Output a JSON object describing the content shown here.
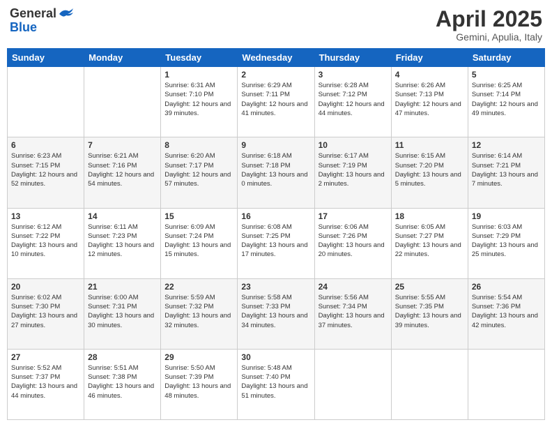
{
  "header": {
    "logo_general": "General",
    "logo_blue": "Blue",
    "month": "April 2025",
    "location": "Gemini, Apulia, Italy"
  },
  "weekdays": [
    "Sunday",
    "Monday",
    "Tuesday",
    "Wednesday",
    "Thursday",
    "Friday",
    "Saturday"
  ],
  "weeks": [
    [
      {
        "day": "",
        "info": ""
      },
      {
        "day": "",
        "info": ""
      },
      {
        "day": "1",
        "info": "Sunrise: 6:31 AM\nSunset: 7:10 PM\nDaylight: 12 hours and 39 minutes."
      },
      {
        "day": "2",
        "info": "Sunrise: 6:29 AM\nSunset: 7:11 PM\nDaylight: 12 hours and 41 minutes."
      },
      {
        "day": "3",
        "info": "Sunrise: 6:28 AM\nSunset: 7:12 PM\nDaylight: 12 hours and 44 minutes."
      },
      {
        "day": "4",
        "info": "Sunrise: 6:26 AM\nSunset: 7:13 PM\nDaylight: 12 hours and 47 minutes."
      },
      {
        "day": "5",
        "info": "Sunrise: 6:25 AM\nSunset: 7:14 PM\nDaylight: 12 hours and 49 minutes."
      }
    ],
    [
      {
        "day": "6",
        "info": "Sunrise: 6:23 AM\nSunset: 7:15 PM\nDaylight: 12 hours and 52 minutes."
      },
      {
        "day": "7",
        "info": "Sunrise: 6:21 AM\nSunset: 7:16 PM\nDaylight: 12 hours and 54 minutes."
      },
      {
        "day": "8",
        "info": "Sunrise: 6:20 AM\nSunset: 7:17 PM\nDaylight: 12 hours and 57 minutes."
      },
      {
        "day": "9",
        "info": "Sunrise: 6:18 AM\nSunset: 7:18 PM\nDaylight: 13 hours and 0 minutes."
      },
      {
        "day": "10",
        "info": "Sunrise: 6:17 AM\nSunset: 7:19 PM\nDaylight: 13 hours and 2 minutes."
      },
      {
        "day": "11",
        "info": "Sunrise: 6:15 AM\nSunset: 7:20 PM\nDaylight: 13 hours and 5 minutes."
      },
      {
        "day": "12",
        "info": "Sunrise: 6:14 AM\nSunset: 7:21 PM\nDaylight: 13 hours and 7 minutes."
      }
    ],
    [
      {
        "day": "13",
        "info": "Sunrise: 6:12 AM\nSunset: 7:22 PM\nDaylight: 13 hours and 10 minutes."
      },
      {
        "day": "14",
        "info": "Sunrise: 6:11 AM\nSunset: 7:23 PM\nDaylight: 13 hours and 12 minutes."
      },
      {
        "day": "15",
        "info": "Sunrise: 6:09 AM\nSunset: 7:24 PM\nDaylight: 13 hours and 15 minutes."
      },
      {
        "day": "16",
        "info": "Sunrise: 6:08 AM\nSunset: 7:25 PM\nDaylight: 13 hours and 17 minutes."
      },
      {
        "day": "17",
        "info": "Sunrise: 6:06 AM\nSunset: 7:26 PM\nDaylight: 13 hours and 20 minutes."
      },
      {
        "day": "18",
        "info": "Sunrise: 6:05 AM\nSunset: 7:27 PM\nDaylight: 13 hours and 22 minutes."
      },
      {
        "day": "19",
        "info": "Sunrise: 6:03 AM\nSunset: 7:29 PM\nDaylight: 13 hours and 25 minutes."
      }
    ],
    [
      {
        "day": "20",
        "info": "Sunrise: 6:02 AM\nSunset: 7:30 PM\nDaylight: 13 hours and 27 minutes."
      },
      {
        "day": "21",
        "info": "Sunrise: 6:00 AM\nSunset: 7:31 PM\nDaylight: 13 hours and 30 minutes."
      },
      {
        "day": "22",
        "info": "Sunrise: 5:59 AM\nSunset: 7:32 PM\nDaylight: 13 hours and 32 minutes."
      },
      {
        "day": "23",
        "info": "Sunrise: 5:58 AM\nSunset: 7:33 PM\nDaylight: 13 hours and 34 minutes."
      },
      {
        "day": "24",
        "info": "Sunrise: 5:56 AM\nSunset: 7:34 PM\nDaylight: 13 hours and 37 minutes."
      },
      {
        "day": "25",
        "info": "Sunrise: 5:55 AM\nSunset: 7:35 PM\nDaylight: 13 hours and 39 minutes."
      },
      {
        "day": "26",
        "info": "Sunrise: 5:54 AM\nSunset: 7:36 PM\nDaylight: 13 hours and 42 minutes."
      }
    ],
    [
      {
        "day": "27",
        "info": "Sunrise: 5:52 AM\nSunset: 7:37 PM\nDaylight: 13 hours and 44 minutes."
      },
      {
        "day": "28",
        "info": "Sunrise: 5:51 AM\nSunset: 7:38 PM\nDaylight: 13 hours and 46 minutes."
      },
      {
        "day": "29",
        "info": "Sunrise: 5:50 AM\nSunset: 7:39 PM\nDaylight: 13 hours and 48 minutes."
      },
      {
        "day": "30",
        "info": "Sunrise: 5:48 AM\nSunset: 7:40 PM\nDaylight: 13 hours and 51 minutes."
      },
      {
        "day": "",
        "info": ""
      },
      {
        "day": "",
        "info": ""
      },
      {
        "day": "",
        "info": ""
      }
    ]
  ]
}
